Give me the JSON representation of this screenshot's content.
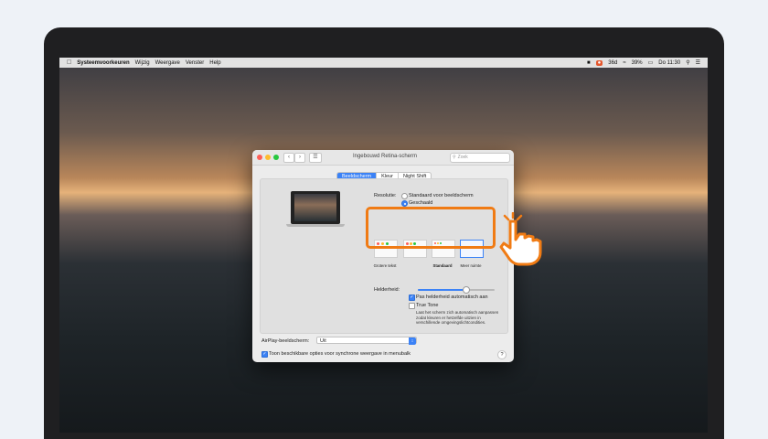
{
  "menubar": {
    "apple": "",
    "app": "Systeemvoorkeuren",
    "items": [
      "Wijzig",
      "Weergave",
      "Venster",
      "Help"
    ],
    "status": [
      "36d",
      "39%",
      "Do 11:30"
    ]
  },
  "window": {
    "title": "Ingebouwd Retina-scherm",
    "search_placeholder": "Zoek",
    "tabs": [
      "Beeldscherm",
      "Kleur",
      "Night Shift"
    ],
    "active_tab": "Beeldscherm",
    "resolution_label": "Resolutie:",
    "resolution_options": [
      "Standaard voor beeldscherm",
      "Geschaald"
    ],
    "resolution_selected": "Geschaald",
    "scale_options": [
      "Grotere tekst",
      "",
      "Standaard",
      "Meer ruimte"
    ],
    "scale_selected": "Meer ruimte",
    "brightness_label": "Helderheid:",
    "brightness_level": 0.62,
    "auto_brightness_label": "Pas helderheid automatisch aan",
    "auto_brightness_checked": true,
    "true_tone_label": "True Tone",
    "true_tone_checked": false,
    "true_tone_desc": "Laat het scherm zich automatisch aanpassen zodat kleuren er hetzelfde uitzien in verschillende omgevingslichtcondities.",
    "airplay_label": "AirPlay-beeldscherm:",
    "airplay_value": "Uit",
    "mirror_label": "Toon beschikbare opties voor synchrone weergave in menubalk",
    "mirror_checked": true,
    "help": "?"
  },
  "colors": {
    "accent": "#3b82f6",
    "highlight": "#f07b14"
  }
}
